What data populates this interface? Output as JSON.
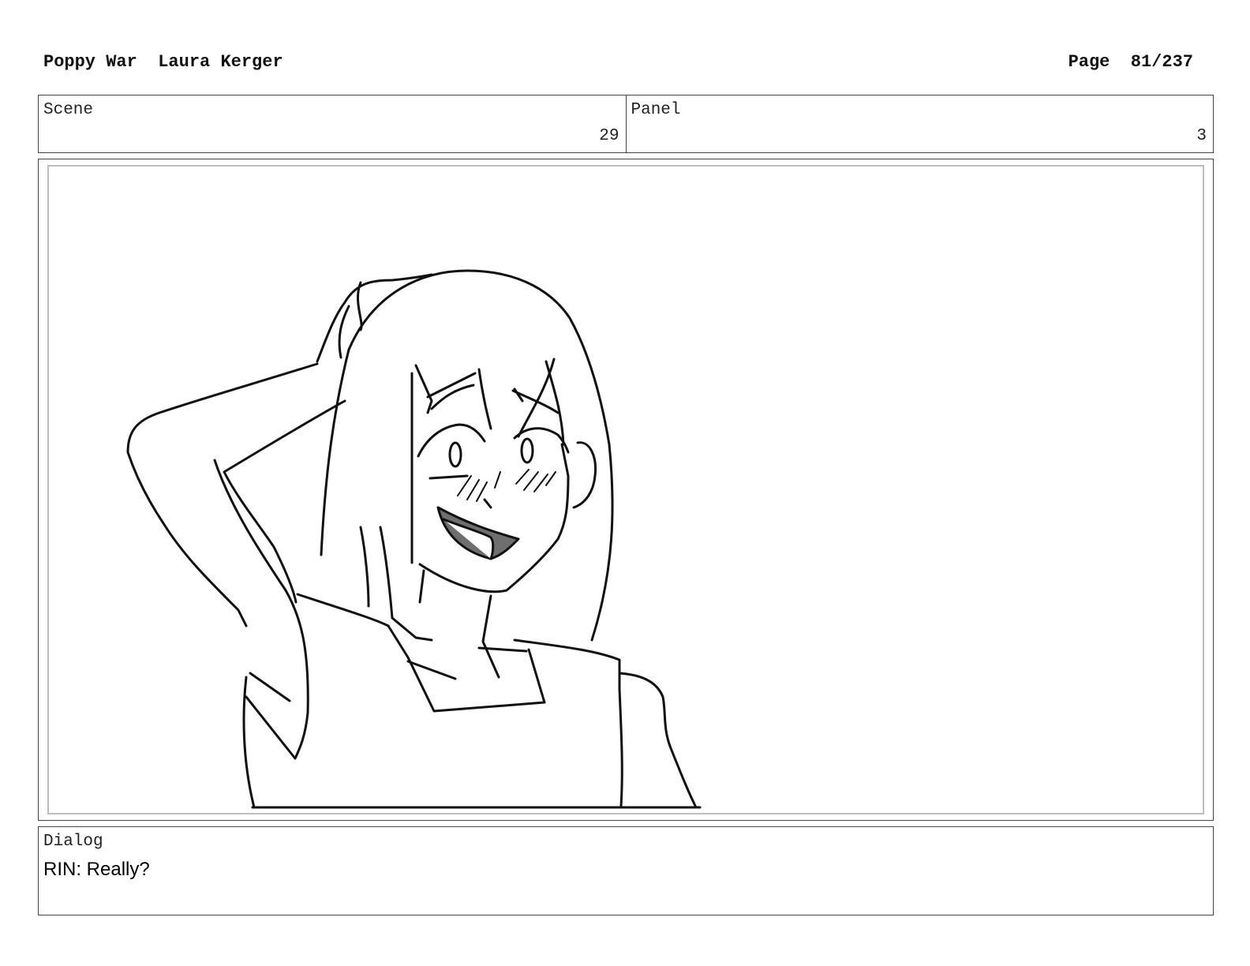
{
  "header": {
    "title": "Poppy War",
    "author": "Laura Kerger",
    "page_label": "Page",
    "page_value": "81/237"
  },
  "info": {
    "scene_label": "Scene",
    "scene_value": "29",
    "panel_label": "Panel",
    "panel_value": "3"
  },
  "dialog": {
    "label": "Dialog",
    "text": "RIN: Really?"
  },
  "colors": {
    "line": "#111111",
    "mouth_fill": "#6f6f6f",
    "frame_border": "#bdbdbd"
  }
}
